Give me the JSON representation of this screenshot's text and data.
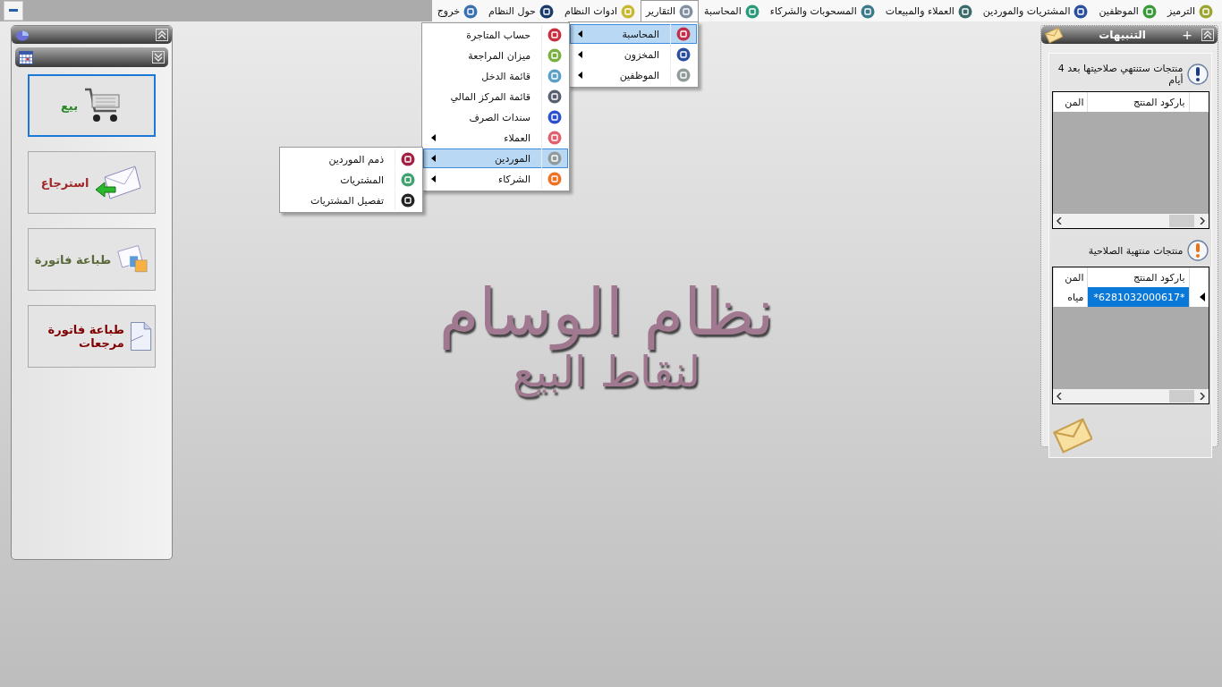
{
  "menubar": [
    {
      "label": "الترميز",
      "color": "#9aa630",
      "selected": false
    },
    {
      "label": "الموظفين",
      "color": "#3a9a3a",
      "selected": false
    },
    {
      "label": "المشتريات والموردين",
      "color": "#2a4f9c",
      "selected": false
    },
    {
      "label": "العملاء والمبيعات",
      "color": "#3a6a6a",
      "selected": false
    },
    {
      "label": "المسحوبات والشركاء",
      "color": "#3a7a8a",
      "selected": false
    },
    {
      "label": "المحاسبة",
      "color": "#2a9a7a",
      "selected": false
    },
    {
      "label": "التقارير",
      "color": "#8090a0",
      "selected": true,
      "children": [
        {
          "label": "المحاسبة",
          "color": "#c0304a",
          "submenu": true,
          "selected": true,
          "children": [
            {
              "label": "حساب المتاجرة",
              "color": "#c83040",
              "submenu": false,
              "selected": false
            },
            {
              "label": "ميزان المراجعة",
              "color": "#7ab040",
              "submenu": false,
              "selected": false
            },
            {
              "label": "قائمة الدخل",
              "color": "#5aa0c8",
              "submenu": false,
              "selected": false
            },
            {
              "label": "قائمة المركز المالي",
              "color": "#5a6070",
              "submenu": false,
              "selected": false
            },
            {
              "label": "سندات الصرف",
              "color": "#2a50d0",
              "submenu": false,
              "selected": false
            },
            {
              "label": "العملاء",
              "color": "#e06070",
              "submenu": true,
              "selected": false
            },
            {
              "label": "الموردين",
              "color": "#909a9a",
              "submenu": true,
              "selected": true,
              "children": [
                {
                  "label": "ذمم الموردين",
                  "color": "#a02040",
                  "submenu": false,
                  "selected": false
                },
                {
                  "label": "المشتريات",
                  "color": "#40a070",
                  "submenu": false,
                  "selected": false
                },
                {
                  "label": "تفصيل المشتريات",
                  "color": "#222222",
                  "submenu": false,
                  "selected": false
                }
              ]
            },
            {
              "label": "الشركاء",
              "color": "#f07020",
              "submenu": true,
              "selected": false
            }
          ]
        },
        {
          "label": "المخزون",
          "color": "#2a4f9c",
          "submenu": true,
          "selected": false
        },
        {
          "label": "الموظفين",
          "color": "#909a9a",
          "submenu": true,
          "selected": false
        }
      ]
    },
    {
      "label": "ادوات النظام",
      "color": "#c8b830",
      "selected": false
    },
    {
      "label": "حول النظام",
      "color": "#1a3a6a",
      "selected": false
    },
    {
      "label": "خروج",
      "color": "#3a70b0",
      "selected": false
    }
  ],
  "shortcuts": [
    {
      "label": "بيع",
      "kind": "cart",
      "color": "#2a8a2a",
      "selected": true
    },
    {
      "label": "استرجاع",
      "kind": "return",
      "color": "#a02828",
      "selected": false
    },
    {
      "label": "طباعة فاتورة",
      "kind": "print",
      "color": "#5a6a3a",
      "selected": false
    },
    {
      "label": "طباعة فاتورة مرجعات",
      "kind": "document",
      "color": "#800000",
      "selected": false
    }
  ],
  "center": {
    "title": "نظام الوسام",
    "subtitle": "لنقاط البيع"
  },
  "alerts": {
    "title": "التنبيهات",
    "add": "+",
    "sections": [
      {
        "kind": "info",
        "title": "منتجات ستنتهي صلاحيتها بعد 4 أيام",
        "columns": [
          "باركود المنتج",
          "المن"
        ]
      },
      {
        "kind": "warning",
        "title": "منتجات منتهية الصلاحية",
        "columns": [
          "باركود المنتج",
          "المن"
        ],
        "rows": [
          {
            "cells": [
              "*6281032000617*",
              "مياه"
            ],
            "selected": true
          }
        ]
      }
    ]
  }
}
